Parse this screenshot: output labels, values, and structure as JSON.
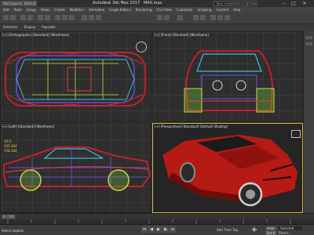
{
  "titlebar": {
    "workspace": "Workspaces: Default",
    "app_title": "Autodesk 3ds Max 2017",
    "file_name": "MAX.max",
    "search_placeholder": "Type a keyword or phrase"
  },
  "menu": [
    "Edit",
    "Tools",
    "Group",
    "Views",
    "Create",
    "Modifiers",
    "Animation",
    "Graph Editors",
    "Rendering",
    "Civil View",
    "Customize",
    "Scripting",
    "Content",
    "Help"
  ],
  "ribbon_tabs": [
    "Selection",
    "Display",
    "Populate"
  ],
  "viewports": {
    "top_left": {
      "label": "[+] [Orthographic] [Standard] [Wireframe]"
    },
    "top_right": {
      "label": "[+] [Front] [Standard] [Wireframe]"
    },
    "bottom_left": {
      "label": "[+] [Left] [Standard] [Wireframe]",
      "values": [
        "10.0",
        "505.364",
        "158.364"
      ]
    },
    "bottom_right": {
      "label": "[+] [Perspective] [Standard] [Default Shading]"
    }
  },
  "timeline": {
    "frame": "0 / 100"
  },
  "status": {
    "selection": "Select objects",
    "add_time_tag": "Add Time Tag",
    "auto_key": "Auto",
    "set_key": "Set K",
    "selected_dropdown": "Selected",
    "filters": "Filters..."
  },
  "colors": {
    "car_body": "#b51a14",
    "active_viewport": "#d6b43a"
  }
}
